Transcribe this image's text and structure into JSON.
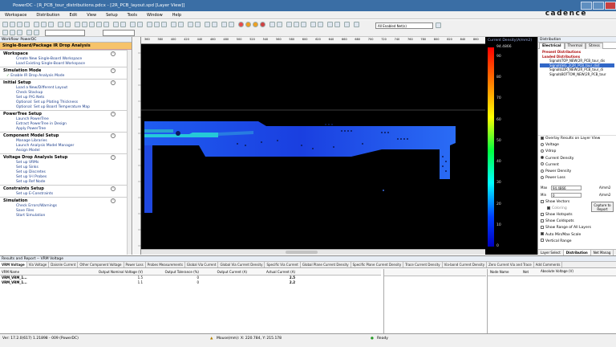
{
  "window": {
    "title": "PowerDC - [R_PCB_tour_distributions.pdcx - [2R_PCB_layout.spd [Layer View]]"
  },
  "menu": [
    "Workspace",
    "Distribution",
    "Edit",
    "View",
    "Setup",
    "Tools",
    "Window",
    "Help"
  ],
  "brand": "cadence",
  "toolbar": {
    "net_filter": "All Enabled Net(s)"
  },
  "workflow": {
    "panel_title": "Workflow: PowerDC",
    "active_tab": "Single-Board/Package IR Drop Analysis",
    "sections": [
      {
        "title": "Workspace",
        "items": [
          "Create New Single-Board Workspace",
          "Load Existing Single-Board Workspace"
        ]
      },
      {
        "title": "Simulation Mode",
        "items": [
          "Enable IR Drop Analysis Mode"
        ],
        "checked_first": true
      },
      {
        "title": "Initial Setup",
        "items": [
          "Load a New/Different Layout",
          "Check Stackup",
          "Set up P/G Nets",
          "Optional: Set up Plating Thickness",
          "Optional: Set up Board Temperature Map"
        ]
      },
      {
        "title": "PowerTree Setup",
        "items": [
          "Launch PowerTree",
          "Extract PowerTree in Design",
          "Apply PowerTree"
        ]
      },
      {
        "title": "Component Model Setup",
        "items": [
          "Manage Libraries",
          "Launch Analysis Model Manager",
          "Assign Model"
        ]
      },
      {
        "title": "Voltage Drop Analysis Setup",
        "items": [
          "Set up VRMs",
          "Set up Sinks",
          "Set up Discretes",
          "Set up V-I Probes",
          "Set up Ref Node"
        ]
      },
      {
        "title": "Constraints Setup",
        "items": [
          "Set up E-Constraints"
        ]
      },
      {
        "title": "Simulation",
        "items": [
          "Check Errors/Warnings",
          "Save Files",
          "Start Simulation"
        ]
      }
    ]
  },
  "ruler": {
    "top_ticks": [
      "360",
      "380",
      "400",
      "420",
      "440",
      "460",
      "480",
      "500",
      "520",
      "540",
      "560",
      "580",
      "600",
      "620",
      "640",
      "660",
      "680",
      "700",
      "720",
      "740",
      "760",
      "780",
      "800",
      "820",
      "840",
      "860"
    ]
  },
  "colorbar": {
    "title": "Current Density(A/mm2)",
    "max_label": "94.4866",
    "ticks": [
      "90",
      "80",
      "70",
      "60",
      "50",
      "40",
      "30",
      "20",
      "10",
      "0"
    ]
  },
  "distribution": {
    "panel_title": "Distribution",
    "tabs": [
      "Electrical",
      "Thermal",
      "Stress"
    ],
    "active_tab": "Electrical",
    "tree": {
      "root1": "Present Distributions",
      "root2": "Loaded Distributions",
      "items": [
        "Signal$TOP_NEW(2R_PCB_tour_dis",
        "Signal$SIG_2(2R_PCB_tour_dist",
        "Signal$LDR_NEW(2R_PCB_tour_di",
        "Signal$BOTTOM_NEW(2R_PCB_tour"
      ],
      "selected_index": 1
    },
    "overlay_label": "Overlay Results on Layer View",
    "options": [
      "Voltage",
      "Vdrop",
      "Current Density",
      "Current",
      "Power Density",
      "Power Loss"
    ],
    "selected_option": "Current Density",
    "max_label": "Max",
    "max_value": "94.4866",
    "max_unit": "A/mm2",
    "min_label": "Min",
    "min_value": "0",
    "min_unit": "A/mm2",
    "show_vectors": "Show Vectors",
    "coloring": "Coloring",
    "capture_button": "Capture to Report",
    "checks": [
      "Show Hotspots",
      "Show Coldspots",
      "Show Range of All Layers",
      "Auto Min/Max Scale",
      "Vertical Range"
    ],
    "checks_on": [
      false,
      false,
      false,
      true,
      false
    ],
    "bottom_tabs": [
      "Layer Select",
      "Distribution",
      "Net Manag"
    ],
    "bottom_active": "Distribution"
  },
  "results": {
    "panel_title": "Results and Report -- VRM Voltage",
    "tabs": [
      "VRM Voltage",
      "Via Voltage",
      "Daisnle Current",
      "Other Component Voltage",
      "Power Loss",
      "Probes Measurements",
      "Global Via Current",
      "Global Via Current Density",
      "Specific Via Current",
      "Global Plane Current Density",
      "Specific Plane Current Density",
      "Trace Current Density",
      "Via-bond Current Density",
      "Zero Current Via and Trace",
      "Add Comments"
    ],
    "active_tab": "VRM Voltage",
    "columns": [
      "VRM Name",
      "Output Nominal Voltage (V)",
      "Output Tolerance (%)",
      "Output Current (A)",
      "Actual Current (A)"
    ],
    "rows": [
      [
        "VRM_VRM_1...",
        "1.5",
        "0",
        "",
        "2.5"
      ],
      [
        "VRM_VRM_1...",
        "1.1",
        "0",
        "",
        "2.2"
      ]
    ],
    "right_columns": [
      "Node Name",
      "Net",
      "Absolute Voltage (V)"
    ]
  },
  "status": {
    "left": "Ver: 17.2.0(617) 1.21898 - 009 (PowerDC)",
    "mouse": "Mouse(mm): X: 220.784, Y: 215.178",
    "ready": "Ready"
  }
}
